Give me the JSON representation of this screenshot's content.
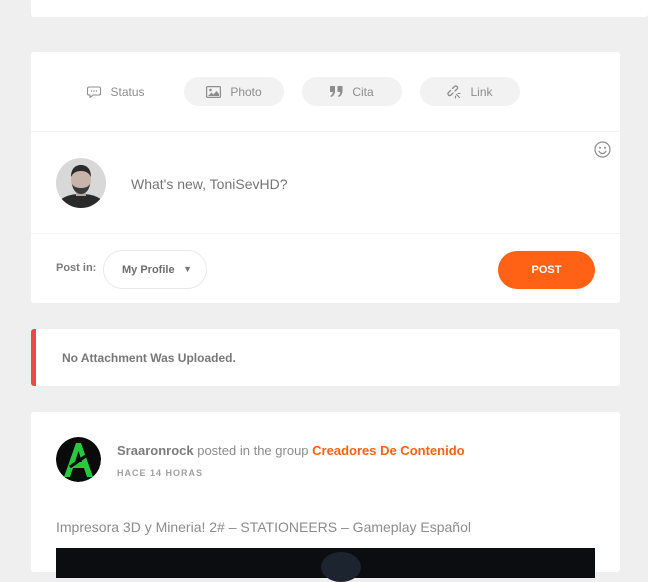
{
  "composer": {
    "tabs": [
      {
        "label": "Status",
        "icon": "speech-bubble-icon"
      },
      {
        "label": "Photo",
        "icon": "image-icon"
      },
      {
        "label": "Cita",
        "icon": "quote-icon"
      },
      {
        "label": "Link",
        "icon": "link-icon"
      }
    ],
    "placeholder": "What's new, ToniSevHD?",
    "post_in_label": "Post in:",
    "post_in_value": "My Profile",
    "post_button": "POST",
    "accent_color": "#ff6115"
  },
  "alert": {
    "message": "No Attachment Was Uploaded.",
    "color": "#f14646"
  },
  "activity": {
    "user": "Sraaronrock",
    "action": "posted in the group",
    "group": "Creadores De Contenido",
    "time": "HACE 14 HORAS",
    "title": "Impresora 3D y Mineria! 2# – STATIONEERS – Gameplay Español"
  }
}
